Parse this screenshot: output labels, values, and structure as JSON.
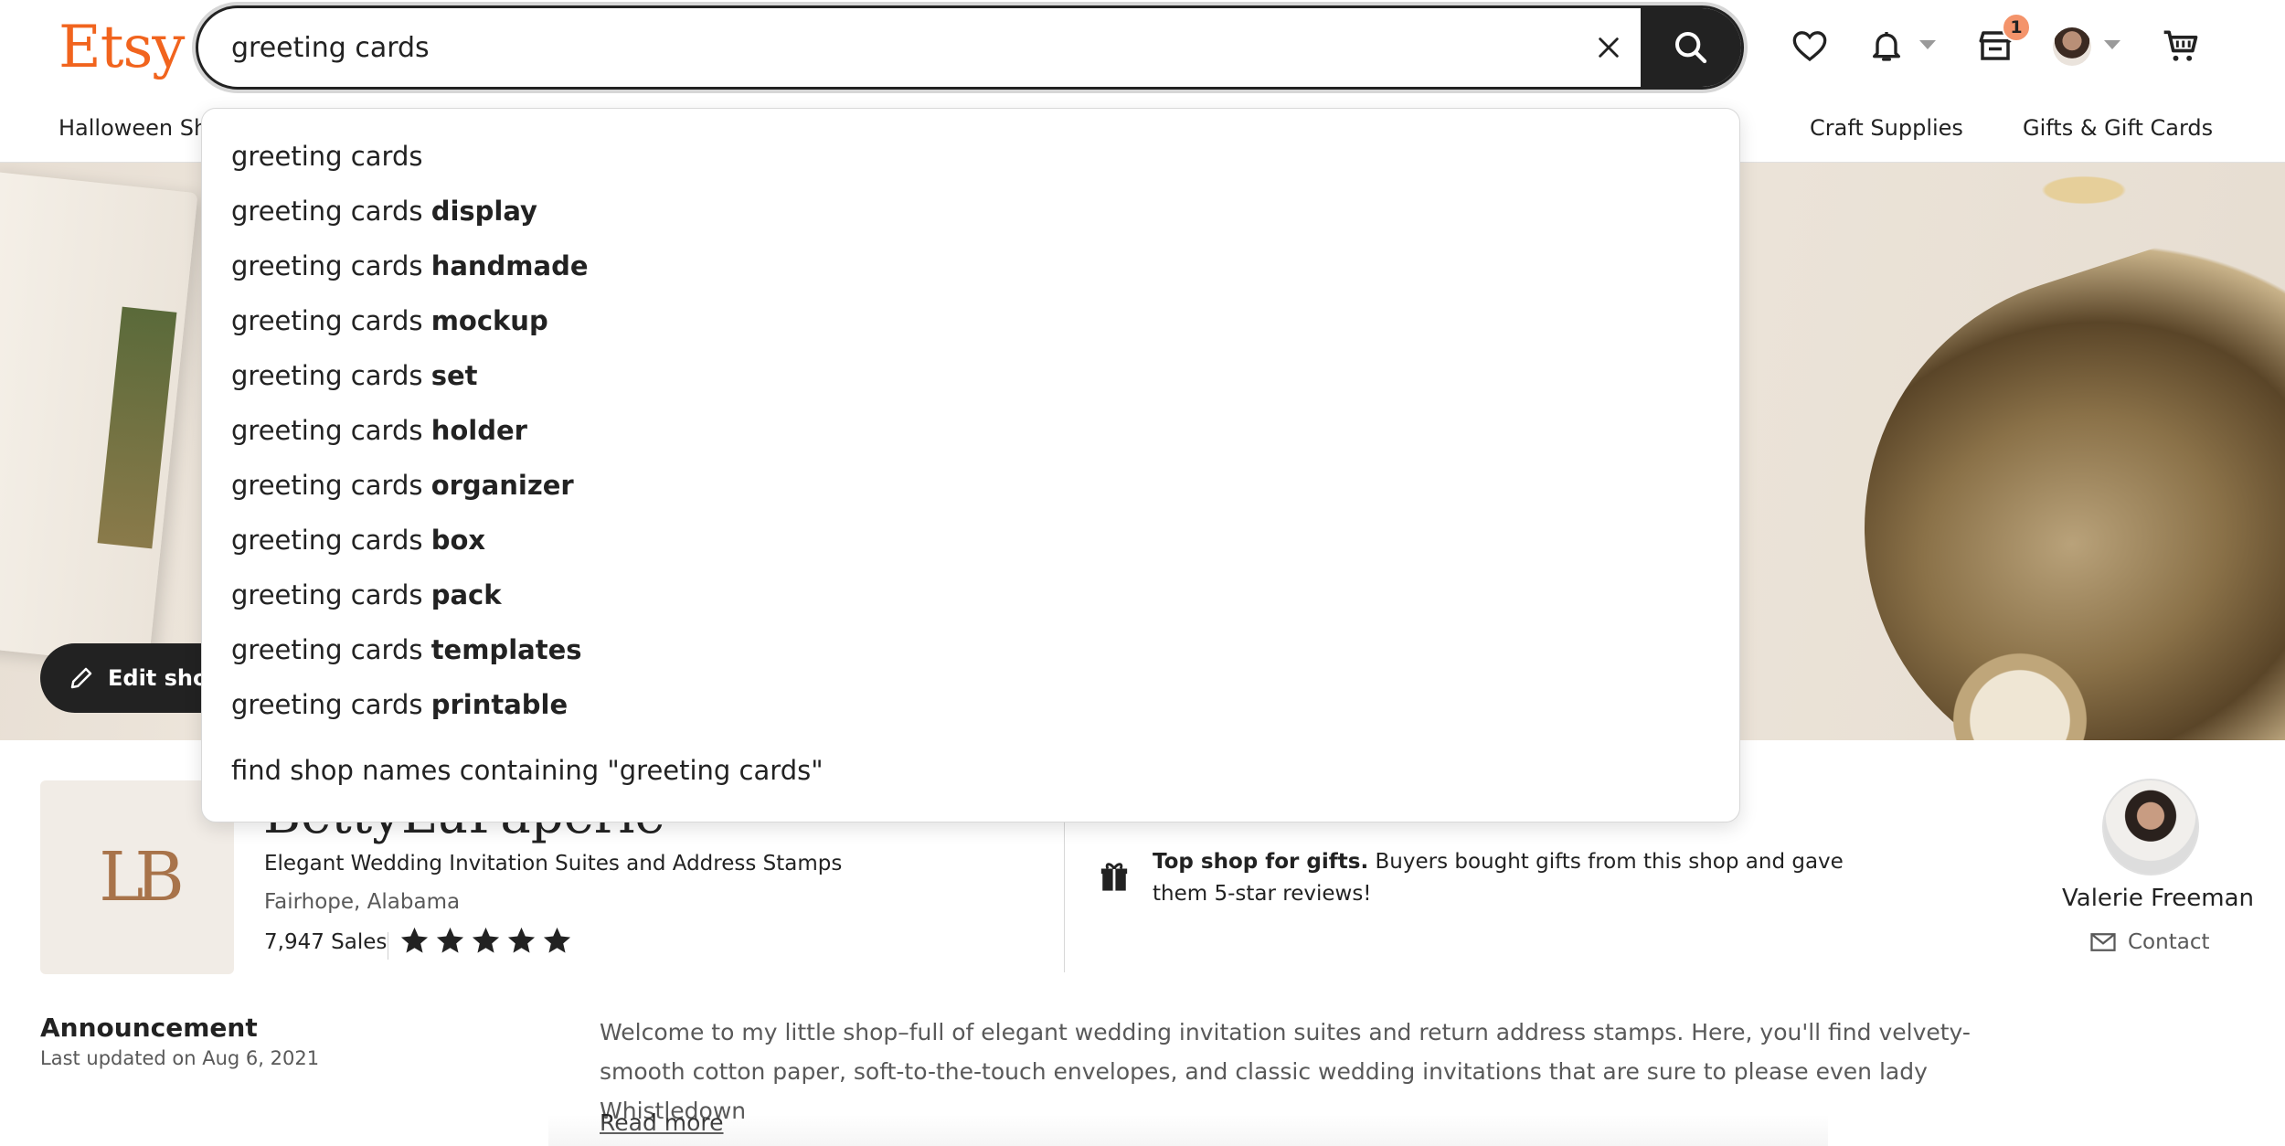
{
  "header": {
    "logo": "Etsy",
    "search_value": "greeting cards",
    "cart_badge": "1"
  },
  "categories": [
    "Halloween Sh",
    "Craft Supplies",
    "Gifts & Gift Cards"
  ],
  "suggestions": [
    {
      "base": "greeting cards",
      "extra": ""
    },
    {
      "base": "greeting cards ",
      "extra": "display"
    },
    {
      "base": "greeting cards ",
      "extra": "handmade"
    },
    {
      "base": "greeting cards ",
      "extra": "mockup"
    },
    {
      "base": "greeting cards ",
      "extra": "set"
    },
    {
      "base": "greeting cards ",
      "extra": "holder"
    },
    {
      "base": "greeting cards ",
      "extra": "organizer"
    },
    {
      "base": "greeting cards ",
      "extra": "box"
    },
    {
      "base": "greeting cards ",
      "extra": "pack"
    },
    {
      "base": "greeting cards ",
      "extra": "templates"
    },
    {
      "base": "greeting cards ",
      "extra": "printable"
    }
  ],
  "shop_name_search": "find shop names containing \"greeting cards\"",
  "banner": {
    "edit_label": "Edit shop"
  },
  "shop": {
    "monogram": "LB",
    "name": "BettyLuPaperie",
    "tagline": "Elegant Wedding Invitation Suites and Address Stamps",
    "location": "Fairhope, Alabama",
    "sales": "7,947 Sales",
    "rating_stars": 5
  },
  "top_shop": {
    "title": "Top shop for gifts.",
    "text": " Buyers bought gifts from this shop and gave them 5-star reviews!"
  },
  "owner": {
    "name": "Valerie Freeman",
    "contact_label": "Contact"
  },
  "announcement": {
    "title": "Announcement",
    "updated": "Last updated on Aug 6, 2021",
    "body": "Welcome to my little shop–full of elegant wedding invitation suites and return address stamps. Here, you'll find velvety-smooth cotton paper, soft-to-the-touch envelopes, and classic wedding invitations that are sure to please even lady Whistledown",
    "read_more": "Read more"
  },
  "colors": {
    "brand": "#f1641e",
    "badge": "#f4946b",
    "dark": "#222222"
  }
}
